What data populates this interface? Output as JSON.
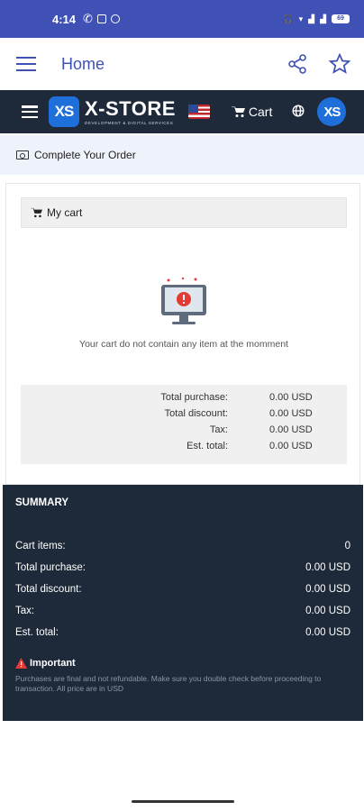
{
  "status_bar": {
    "time": "4:14",
    "battery": "69"
  },
  "app_bar": {
    "title": "Home"
  },
  "site_header": {
    "logo_text": "XS",
    "brand_name": "X-STORE",
    "brand_tagline": "DEVELOPMENT & DIGITAL SERVICES",
    "cart_label": "Cart",
    "avatar_text": "XS"
  },
  "order_bar": {
    "label": "Complete Your Order"
  },
  "cart": {
    "header": "My cart",
    "empty_message": "Your cart do not contain any item at the momment",
    "totals": [
      {
        "label": "Total purchase:",
        "value": "0.00 USD"
      },
      {
        "label": "Total discount:",
        "value": "0.00 USD"
      },
      {
        "label": "Tax:",
        "value": "0.00 USD"
      },
      {
        "label": "Est. total:",
        "value": "0.00 USD"
      }
    ]
  },
  "summary": {
    "title": "SUMMARY",
    "rows": [
      {
        "label": "Cart items:",
        "value": "0"
      },
      {
        "label": "Total purchase:",
        "value": "0.00 USD"
      },
      {
        "label": "Total discount:",
        "value": "0.00 USD"
      },
      {
        "label": "Tax:",
        "value": "0.00 USD"
      },
      {
        "label": "Est. total:",
        "value": "0.00 USD"
      }
    ],
    "important_label": "Important",
    "important_note": "Purchases are final and not refundable. Make sure you double check before proceeding to transaction. All price are in USD"
  },
  "colors": {
    "status_bar": "#3f51b5",
    "dark_panel": "#1e2a3a",
    "accent_blue": "#1e6fd9",
    "warning_red": "#e53935"
  }
}
